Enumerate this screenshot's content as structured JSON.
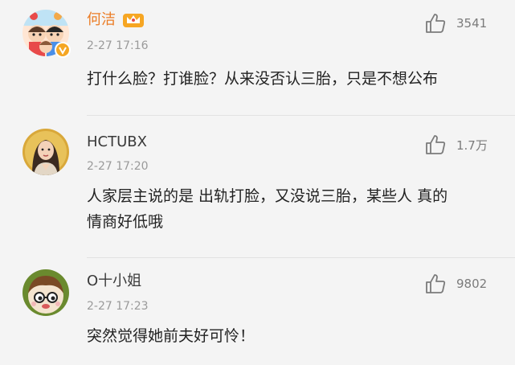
{
  "comments": [
    {
      "username": "何洁",
      "timestamp": "2-27 17:16",
      "text": "打什么脸？打谁脸？从来没否认三胎，只是不想公布",
      "likes": "3541",
      "username_color": "#eb7d26",
      "avatar_icon": "cartoon-kids-avatar",
      "badges": [
        "vip-crown-icon",
        "verified-v-icon"
      ]
    },
    {
      "username": "HCTUBX",
      "timestamp": "2-27 17:20",
      "text": "人家层主说的是 出轨打脸，又没说三胎，某些人 真的\n情商好低哦",
      "likes": "1.7万",
      "username_color": "#3a3a3a",
      "avatar_icon": "woman-photo-avatar"
    },
    {
      "username": "O十小姐",
      "timestamp": "2-27 17:23",
      "text": "突然觉得她前夫好可怜！",
      "likes": "9802",
      "username_color": "#3a3a3a",
      "avatar_icon": "cartoon-face-avatar"
    }
  ],
  "like_icon": "thumbs-up-icon"
}
